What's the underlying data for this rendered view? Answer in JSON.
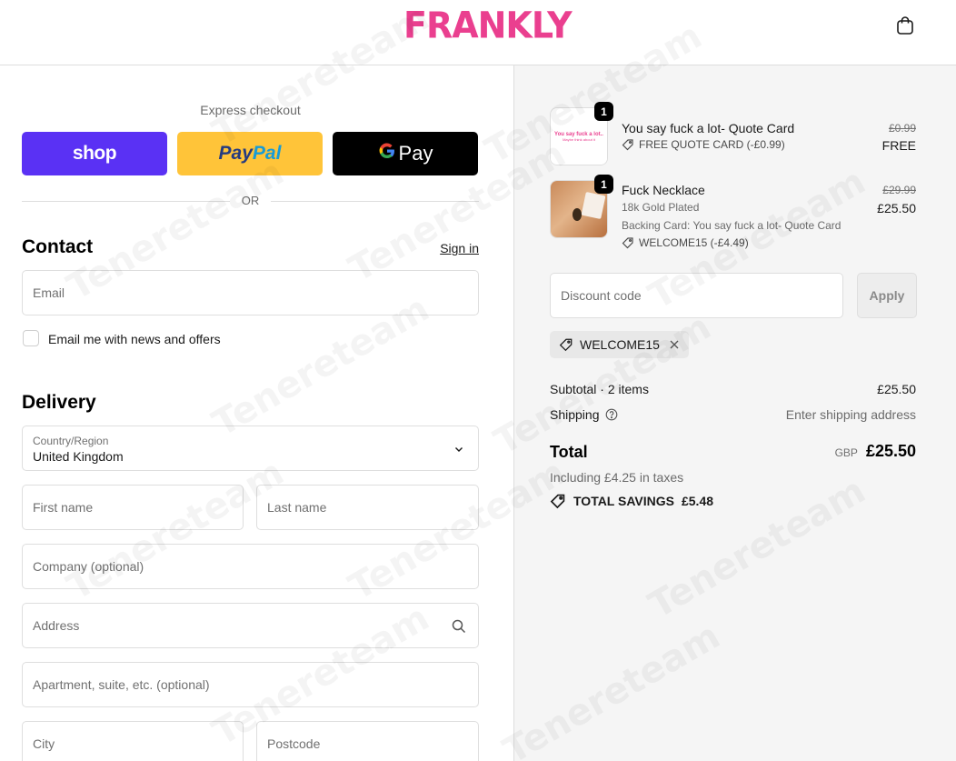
{
  "header": {
    "logo_text": "FRANKLY",
    "cart_icon": "shopping-bag-icon"
  },
  "express": {
    "title": "Express checkout",
    "shop_label": "shop",
    "paypal_label_1": "Pay",
    "paypal_label_2": "Pal",
    "gpay_g": "G",
    "gpay_label": "Pay",
    "or_label": "OR"
  },
  "contact": {
    "heading": "Contact",
    "signin": "Sign in",
    "email_placeholder": "Email",
    "newsletter_label": "Email me with news and offers",
    "newsletter_checked": false
  },
  "delivery": {
    "heading": "Delivery",
    "country_label": "Country/Region",
    "country_value": "United Kingdom",
    "first_name": "First name",
    "last_name": "Last name",
    "company": "Company (optional)",
    "address": "Address",
    "apartment": "Apartment, suite, etc. (optional)",
    "city": "City",
    "postcode": "Postcode"
  },
  "summary": {
    "items": [
      {
        "qty": "1",
        "title": "You say fuck a lot- Quote Card",
        "discount": "FREE QUOTE CARD (-£0.99)",
        "price_old": "£0.99",
        "price_new": "FREE",
        "thumb_text_1": "You say fuck a lot..",
        "thumb_text_2": "Maybe think about it"
      },
      {
        "qty": "1",
        "title": "Fuck Necklace",
        "variant": "18k Gold Plated",
        "backing": "Backing Card: You say fuck a lot- Quote Card",
        "discount": "WELCOME15 (-£4.49)",
        "price_old": "£29.99",
        "price_new": "£25.50"
      }
    ],
    "discount_placeholder": "Discount code",
    "apply_label": "Apply",
    "applied_code": "WELCOME15",
    "subtotal_label": "Subtotal · 2 items",
    "subtotal_value": "£25.50",
    "shipping_label": "Shipping",
    "shipping_value": "Enter shipping address",
    "total_label": "Total",
    "total_currency": "GBP",
    "total_value": "£25.50",
    "tax_note": "Including £4.25 in taxes",
    "savings_label": "TOTAL SAVINGS",
    "savings_value": "£5.48"
  },
  "colors": {
    "brand_pink": "#ea3f8f",
    "shop_purple": "#5a31f4",
    "paypal_yellow": "#ffc439",
    "summary_bg": "#f5f5f5"
  },
  "watermark": "Tenereteam"
}
